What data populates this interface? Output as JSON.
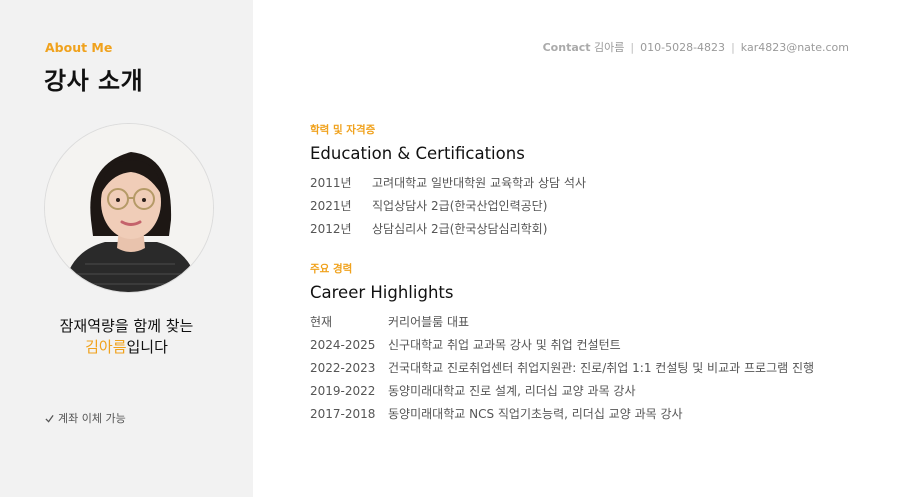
{
  "sidebar": {
    "eyebrow": "About Me",
    "title": "강사 소개",
    "tagline_line1": "잠재역량을 함께 찾는",
    "tagline_name": "김아름",
    "tagline_suffix": "입니다",
    "note": "계좌 이체 가능"
  },
  "contact": {
    "label": "Contact",
    "name": "김아름",
    "phone": "010-5028-4823",
    "email": "kar4823@nate.com"
  },
  "education": {
    "eyebrow": "학력 및 자격증",
    "title": "Education & Certifications",
    "items": [
      {
        "year": "2011년",
        "text": "고려대학교 일반대학원 교육학과 상담 석사"
      },
      {
        "year": "2021년",
        "text": "직업상담사 2급(한국산업인력공단)"
      },
      {
        "year": "2012년",
        "text": "상담심리사 2급(한국상담심리학회)"
      }
    ]
  },
  "career": {
    "eyebrow": "주요 경력",
    "title": "Career Highlights",
    "items": [
      {
        "year": "현재",
        "text": "커리어블룸 대표"
      },
      {
        "year": "2024-2025",
        "text": "신구대학교 취업 교과목 강사 및 취업 컨설턴트"
      },
      {
        "year": "2022-2023",
        "text": "건국대학교 진로취업센터 취업지원관: 진로/취업 1:1 컨설팅 및 비교과 프로그램 진행"
      },
      {
        "year": "2019-2022",
        "text": "동양미래대학교 진로 설계, 리더십 교양 과목 강사"
      },
      {
        "year": "2017-2018",
        "text": "동양미래대학교 NCS 직업기초능력, 리더십 교양 과목 강사"
      }
    ]
  },
  "colors": {
    "accent": "#f0a21d",
    "sidebar_bg": "#f2f2f2"
  }
}
